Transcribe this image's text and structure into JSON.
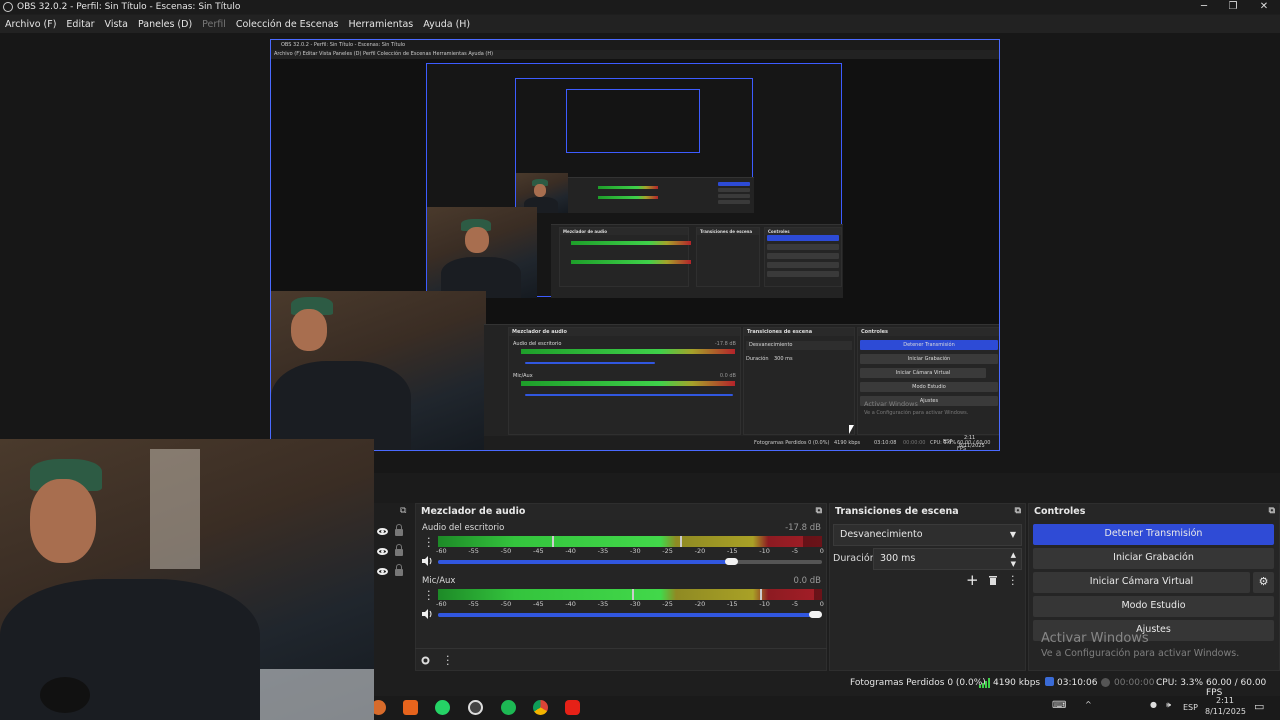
{
  "window": {
    "title": "OBS 32.0.2 - Perfil: Sin Título - Escenas: Sin Título",
    "minimize": "─",
    "maximize": "❐",
    "close": "✕"
  },
  "menu": [
    "Archivo (F)",
    "Editar",
    "Vista",
    "Paneles (D)",
    "Perfil",
    "Colección de Escenas",
    "Herramientas",
    "Ayuda (H)"
  ],
  "preview_inner": {
    "title": "OBS 32.0.2 - Perfil: Sin Título - Escenas: Sin Título",
    "menu": "Archivo (F)   Editar   Vista   Paneles (D)   Perfil   Colección de Escenas   Herramientas   Ayuda (H)",
    "mixer_title": "Mezclador de audio",
    "transitions_title": "Transiciones de escena",
    "controls_title": "Controles",
    "track1": "Audio del escritorio",
    "track1_db": "-17.8 dB",
    "track2": "Mic/Aux",
    "track2_db": "0.0 dB",
    "transition": "Desvanecimiento",
    "duration_label": "Duración",
    "duration": "300 ms",
    "btn_stop": "Detener Transmisión",
    "btn_record": "Iniciar Grabación",
    "btn_vcam": "Iniciar Cámara Virtual",
    "btn_studio": "Modo Estudio",
    "btn_settings": "Ajustes",
    "wm1": "Activar Windows",
    "wm2": "Ve a Configuración para activar Windows.",
    "status": "Fotogramas Perdidos 0 (0.0%)",
    "kbps": "4190 kbps",
    "time": "03:10:08",
    "rec": "00:00:00",
    "cpu": "CPU: 3.3%",
    "fps": "60.00 / 60.00 FPS",
    "clock": "2:11",
    "date": "8/11/2025",
    "lang": "ESP"
  },
  "mixer": {
    "title": "Mezclador de audio",
    "scale": [
      "-60",
      "-55",
      "-50",
      "-45",
      "-40",
      "-35",
      "-30",
      "-25",
      "-20",
      "-15",
      "-10",
      "-5",
      "0"
    ],
    "tracks": [
      {
        "name": "Audio del escritorio",
        "db": "-17.8 dB",
        "level": 0.8,
        "volume": 0.78
      },
      {
        "name": "Mic/Aux",
        "db": "0.0 dB",
        "level": 0.88,
        "volume": 1.0
      }
    ]
  },
  "transitions": {
    "title": "Transiciones de escena",
    "selected": "Desvanecimiento",
    "duration_label": "Duración",
    "duration": "300 ms"
  },
  "controls": {
    "title": "Controles",
    "stop_stream": "Detener Transmisión",
    "start_recording": "Iniciar Grabación",
    "start_virtual_cam": "Iniciar Cámara Virtual",
    "studio_mode": "Modo Estudio",
    "settings": "Ajustes"
  },
  "watermark": {
    "line1": "Activar Windows",
    "line2": "Ve a Configuración para activar Windows."
  },
  "status": {
    "dropped": "Fotogramas Perdidos 0 (0.0%)",
    "bitrate": "4190 kbps",
    "stream_time": "03:10:06",
    "rec_time": "00:00:00",
    "cpu": "CPU: 3.3%",
    "fps": "60.00 / 60.00 FPS"
  },
  "taskbar": {
    "lang": "ESP",
    "time": "2:11",
    "date": "8/11/2025",
    "undock_icon": "⧉"
  },
  "colors": {
    "accent": "#2f4bd6",
    "preview_border": "#4a6aff"
  }
}
